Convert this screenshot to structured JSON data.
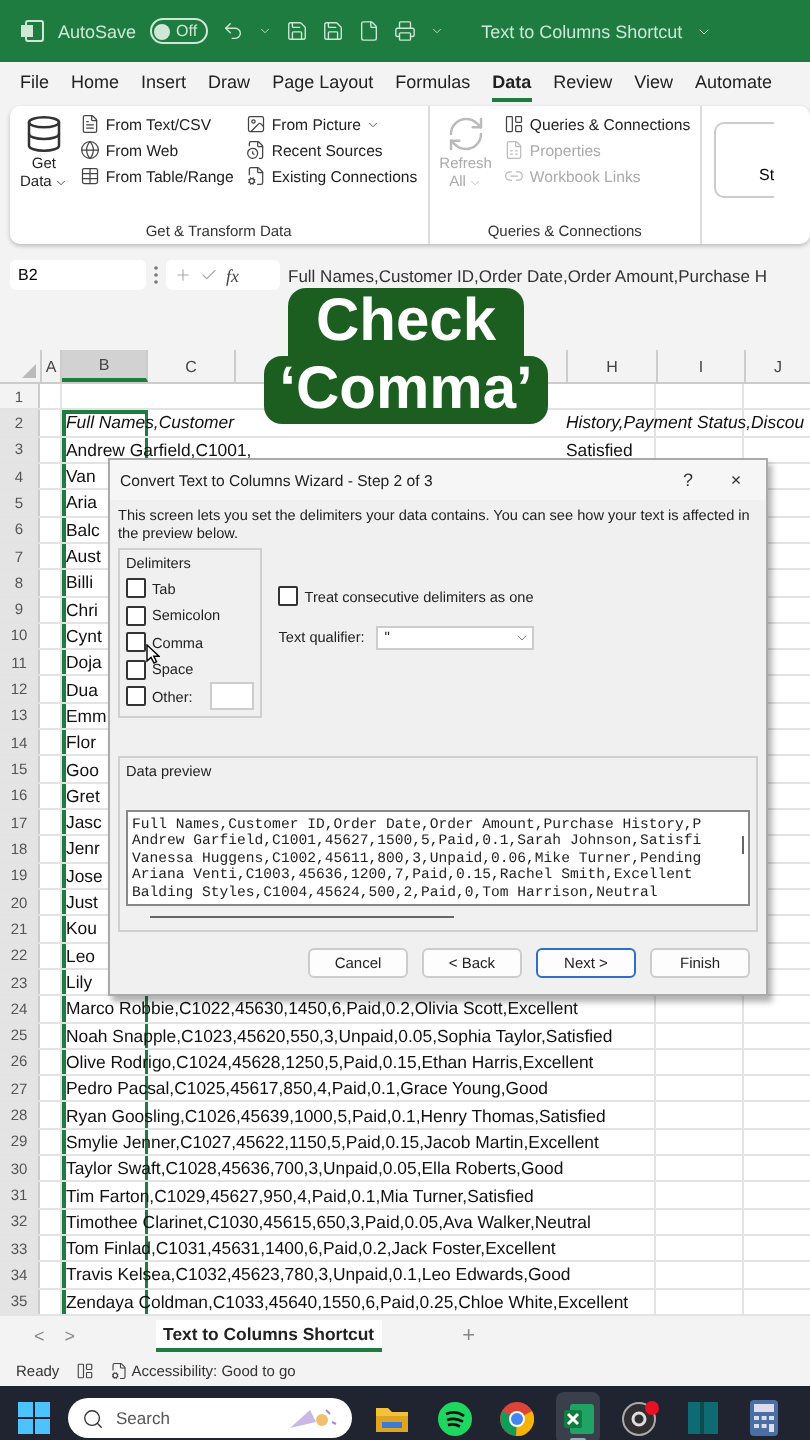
{
  "title_bar": {
    "autosave_label": "AutoSave",
    "autosave_toggle": {
      "label": "Off",
      "on": false
    },
    "document_title": "Text to Columns Shortcut"
  },
  "menu_tabs": [
    {
      "label": "File",
      "selected": false
    },
    {
      "label": "Home",
      "selected": false
    },
    {
      "label": "Insert",
      "selected": false
    },
    {
      "label": "Draw",
      "selected": false
    },
    {
      "label": "Page Layout",
      "selected": false
    },
    {
      "label": "Formulas",
      "selected": false
    },
    {
      "label": "Data",
      "selected": true
    },
    {
      "label": "Review",
      "selected": false
    },
    {
      "label": "View",
      "selected": false
    },
    {
      "label": "Automate",
      "selected": false
    }
  ],
  "ribbon": {
    "groups": [
      {
        "label": "Get & Transform Data",
        "large_button": {
          "lines": [
            "Get",
            "Data"
          ],
          "disabled": false
        },
        "columns": [
          [
            {
              "label": "From Text/CSV",
              "disabled": false
            },
            {
              "label": "From Web",
              "disabled": false
            },
            {
              "label": "From Table/Range",
              "disabled": false
            }
          ],
          [
            {
              "label": "From Picture",
              "disabled": false,
              "dropdown": true
            },
            {
              "label": "Recent Sources",
              "disabled": false
            },
            {
              "label": "Existing Connections",
              "disabled": false
            }
          ]
        ]
      },
      {
        "label": "Queries & Connections",
        "large_button": {
          "lines": [
            "Refresh",
            "All"
          ],
          "disabled": true
        },
        "columns": [
          [
            {
              "label": "Queries & Connections",
              "disabled": false
            },
            {
              "label": "Properties",
              "disabled": true
            },
            {
              "label": "Workbook Links",
              "disabled": true
            }
          ]
        ]
      }
    ],
    "cut_button": "St"
  },
  "formula_bar": {
    "name_box": "B2",
    "fx": "fx",
    "formula": "Full Names,Customer ID,Order Date,Order Amount,Purchase H"
  },
  "caption": {
    "lines": [
      "Check",
      "‘Comma’"
    ]
  },
  "sheet": {
    "columns": [
      {
        "kind": "column",
        "label": "A",
        "selected": false
      },
      {
        "kind": "column",
        "label": "B",
        "selected": true
      },
      {
        "kind": "column",
        "label": "C",
        "selected": false
      },
      {
        "kind": "covered"
      },
      {
        "kind": "column",
        "label": "H",
        "selected": false
      },
      {
        "kind": "column",
        "label": "I",
        "selected": false
      },
      {
        "kind": "column",
        "label": "J",
        "selected": false
      }
    ],
    "rows": [
      {
        "number": "1",
        "kind": "data",
        "selected": false
      },
      {
        "number": "2",
        "kind": "header",
        "selected": true,
        "text": "Full Names,Customer",
        "tail": "History,Payment Status,Discou"
      },
      {
        "number": "3",
        "kind": "data",
        "selected": true,
        "text": "Andrew Garfield,C1001,",
        "tail": "Satisfied"
      },
      {
        "number": "4",
        "kind": "data",
        "selected": true,
        "text": "Van"
      },
      {
        "number": "5",
        "kind": "data",
        "selected": true,
        "text": "Aria"
      },
      {
        "number": "6",
        "kind": "data",
        "selected": true,
        "text": "Balc"
      },
      {
        "number": "7",
        "kind": "data",
        "selected": true,
        "text": "Aust"
      },
      {
        "number": "8",
        "kind": "data",
        "selected": true,
        "text": "Billi"
      },
      {
        "number": "9",
        "kind": "data",
        "selected": true,
        "text": "Chri"
      },
      {
        "number": "10",
        "kind": "data",
        "selected": true,
        "text": "Cynt"
      },
      {
        "number": "11",
        "kind": "data",
        "selected": true,
        "text": "Doja"
      },
      {
        "number": "12",
        "kind": "data",
        "selected": true,
        "text": "Dua"
      },
      {
        "number": "13",
        "kind": "data",
        "selected": true,
        "text": "Emm"
      },
      {
        "number": "14",
        "kind": "data",
        "selected": true,
        "text": "Flor"
      },
      {
        "number": "15",
        "kind": "data",
        "selected": true,
        "text": "Goo"
      },
      {
        "number": "16",
        "kind": "data",
        "selected": true,
        "text": "Gret"
      },
      {
        "number": "17",
        "kind": "data",
        "selected": true,
        "text": "Jasc"
      },
      {
        "number": "18",
        "kind": "data",
        "selected": true,
        "text": "Jenr"
      },
      {
        "number": "19",
        "kind": "data",
        "selected": true,
        "text": "Jose"
      },
      {
        "number": "20",
        "kind": "data",
        "selected": true,
        "text": "Just"
      },
      {
        "number": "21",
        "kind": "data",
        "selected": true,
        "text": "Kou"
      },
      {
        "number": "22",
        "kind": "data",
        "selected": true,
        "text": "Leo"
      },
      {
        "number": "23",
        "kind": "data",
        "selected": true,
        "text": "Lily"
      },
      {
        "number": "24",
        "kind": "data",
        "selected": true,
        "text": "Marco Robbie,C1022,45630,1450,6,Paid,0.2,Olivia Scott,Excellent"
      },
      {
        "number": "25",
        "kind": "data",
        "selected": true,
        "text": "Noah Snapple,C1023,45620,550,3,Unpaid,0.05,Sophia Taylor,Satisfied"
      },
      {
        "number": "26",
        "kind": "data",
        "selected": true,
        "text": "Olive Rodrigo,C1024,45628,1250,5,Paid,0.15,Ethan Harris,Excellent"
      },
      {
        "number": "27",
        "kind": "data",
        "selected": true,
        "text": "Pedro Pacsal,C1025,45617,850,4,Paid,0.1,Grace Young,Good"
      },
      {
        "number": "28",
        "kind": "data",
        "selected": true,
        "text": "Ryan Goosling,C1026,45639,1000,5,Paid,0.1,Henry Thomas,Satisfied"
      },
      {
        "number": "29",
        "kind": "data",
        "selected": true,
        "text": "Smylie Jenner,C1027,45622,1150,5,Paid,0.15,Jacob Martin,Excellent"
      },
      {
        "number": "30",
        "kind": "data",
        "selected": true,
        "text": "Taylor Swaft,C1028,45636,700,3,Unpaid,0.05,Ella Roberts,Good"
      },
      {
        "number": "31",
        "kind": "data",
        "selected": true,
        "text": "Tim Farton,C1029,45627,950,4,Paid,0.1,Mia Turner,Satisfied"
      },
      {
        "number": "32",
        "kind": "data",
        "selected": true,
        "text": "Timothee Clarinet,C1030,45615,650,3,Paid,0.05,Ava Walker,Neutral"
      },
      {
        "number": "33",
        "kind": "data",
        "selected": true,
        "text": "Tom Finlad,C1031,45631,1400,6,Paid,0.2,Jack Foster,Excellent"
      },
      {
        "number": "34",
        "kind": "data",
        "selected": true,
        "text": "Travis Kelsea,C1032,45623,780,3,Unpaid,0.1,Leo Edwards,Good"
      },
      {
        "number": "35",
        "kind": "data",
        "selected": true,
        "text": "Zendaya Coldman,C1033,45640,1550,6,Paid,0.25,Chloe White,Excellent"
      }
    ]
  },
  "dialog": {
    "title": "Convert Text to Columns Wizard - Step 2 of 3",
    "help": "?",
    "close": "×",
    "description": "This screen lets you set the delimiters your data contains.  You can see how your text is affected in the preview below.",
    "delimiters_label": "Delimiters",
    "delimiters": [
      {
        "label": "Tab",
        "checked": false
      },
      {
        "label": "Semicolon",
        "checked": false
      },
      {
        "label": "Comma",
        "checked": false
      },
      {
        "label": "Space",
        "checked": false
      },
      {
        "label": "Other:",
        "checked": false,
        "has_field": true
      }
    ],
    "consecutive": {
      "label": "Treat consecutive delimiters as one",
      "checked": false
    },
    "qualifier": {
      "label": "Text qualifier:",
      "value": "\""
    },
    "preview_label": "Data preview",
    "preview_lines": [
      "Full Names,Customer ID,Order Date,Order Amount,Purchase History,P",
      "Andrew Garfield,C1001,45627,1500,5,Paid,0.1,Sarah Johnson,Satisfi",
      "Vanessa Huggens,C1002,45611,800,3,Unpaid,0.06,Mike Turner,Pending",
      "Ariana Venti,C1003,45636,1200,7,Paid,0.15,Rachel Smith,Excellent",
      "Balding Styles,C1004,45624,500,2,Paid,0,Tom Harrison,Neutral"
    ],
    "buttons": [
      {
        "label": "Cancel",
        "default": false
      },
      {
        "label": "< Back",
        "default": false
      },
      {
        "label": "Next >",
        "default": true
      },
      {
        "label": "Finish",
        "default": false
      }
    ]
  },
  "sheet_tabs": {
    "prev": "<",
    "next": ">",
    "tabs": [
      {
        "label": "Text to Columns Shortcut",
        "selected": true
      }
    ],
    "add": "+"
  },
  "status_bar": {
    "ready": "Ready",
    "accessibility": "Accessibility: Good to go"
  },
  "taskbar": {
    "search_placeholder": "Search",
    "apps": [
      {
        "kind": "folder",
        "active": false
      },
      {
        "kind": "music",
        "active": false
      },
      {
        "kind": "browser",
        "active": false
      },
      {
        "kind": "spreadsheet",
        "active": true
      },
      {
        "kind": "recorder",
        "active": false
      },
      {
        "kind": "book",
        "active": false
      },
      {
        "kind": "calculator",
        "active": false
      }
    ]
  }
}
